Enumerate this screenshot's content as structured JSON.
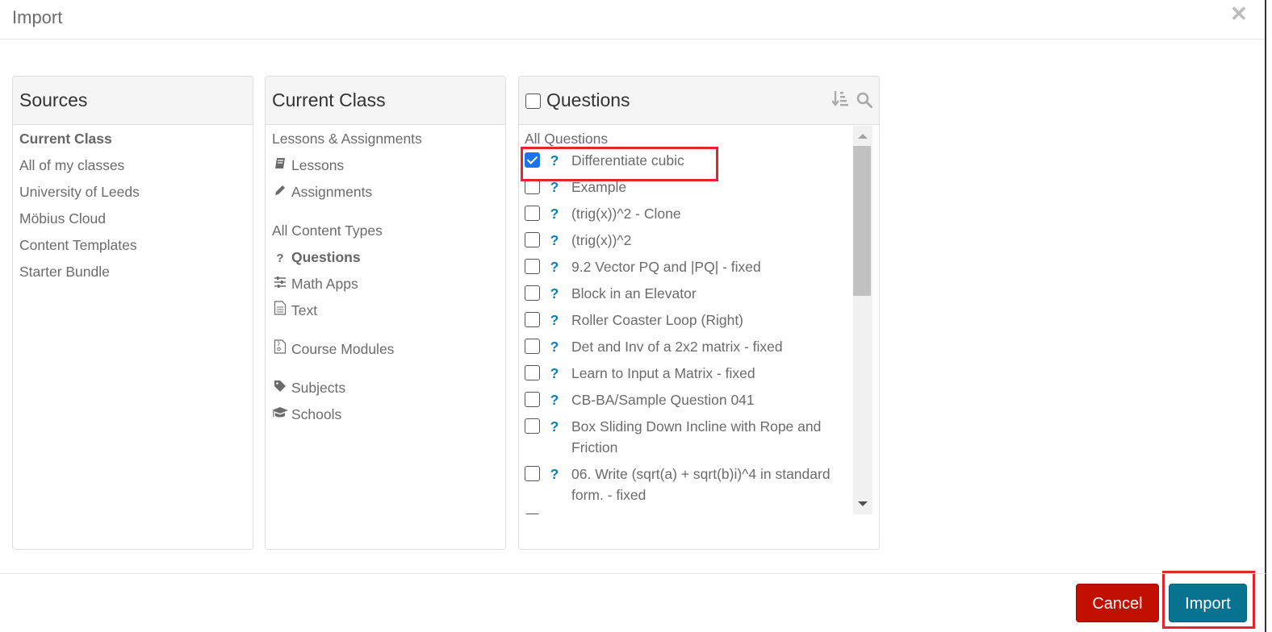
{
  "modal": {
    "title": "Import",
    "close_icon": "close-x-icon"
  },
  "sources": {
    "title": "Sources",
    "items": [
      {
        "label": "Current Class",
        "active": true
      },
      {
        "label": "All of my classes"
      },
      {
        "label": "University of Leeds"
      },
      {
        "label": "Möbius Cloud"
      },
      {
        "label": "Content Templates"
      },
      {
        "label": "Starter Bundle"
      }
    ]
  },
  "current_class": {
    "title": "Current Class",
    "groups": [
      {
        "heading": "Lessons & Assignments",
        "items": [
          {
            "label": "Lessons",
            "icon": "book-icon"
          },
          {
            "label": "Assignments",
            "icon": "pencil-icon"
          }
        ]
      },
      {
        "heading": "All Content Types",
        "items": [
          {
            "label": "Questions",
            "icon": "question-icon",
            "active": true
          },
          {
            "label": "Math Apps",
            "icon": "sliders-icon"
          },
          {
            "label": "Text",
            "icon": "document-icon"
          }
        ]
      },
      {
        "items": [
          {
            "label": "Course Modules",
            "icon": "archive-file-icon"
          }
        ]
      },
      {
        "items": [
          {
            "label": "Subjects",
            "icon": "tag-icon"
          },
          {
            "label": "Schools",
            "icon": "graduation-cap-icon"
          }
        ]
      }
    ]
  },
  "questions": {
    "title": "Questions",
    "select_all_checked": false,
    "tools": [
      "sort-icon",
      "search-icon"
    ],
    "list_heading": "All Questions",
    "items": [
      {
        "label": "Differentiate cubic",
        "checked": true
      },
      {
        "label": "Example",
        "checked": false
      },
      {
        "label": "(trig(x))^2 - Clone",
        "checked": false
      },
      {
        "label": "(trig(x))^2",
        "checked": false
      },
      {
        "label": "9.2 Vector PQ and |PQ| - fixed",
        "checked": false
      },
      {
        "label": "Block in an Elevator",
        "checked": false
      },
      {
        "label": "Roller Coaster Loop (Right)",
        "checked": false
      },
      {
        "label": "Det and Inv of a 2x2 matrix - fixed",
        "checked": false
      },
      {
        "label": "Learn to Input a Matrix - fixed",
        "checked": false
      },
      {
        "label": "CB-BA/Sample Question 041",
        "checked": false
      },
      {
        "label": "Box Sliding Down Incline with Rope and Friction",
        "checked": false
      },
      {
        "label": "06. Write (sqrt(a) + sqrt(b)i)^4 in standard form. - fixed",
        "checked": false
      },
      {
        "label": "",
        "checked": false
      }
    ]
  },
  "footer": {
    "cancel_label": "Cancel",
    "import_label": "Import"
  },
  "colors": {
    "cancel": "#c10f00",
    "import": "#087390",
    "question_icon": "#0c7fb4",
    "highlight": "#e3262c",
    "checkbox_checked": "#1a73e8"
  }
}
